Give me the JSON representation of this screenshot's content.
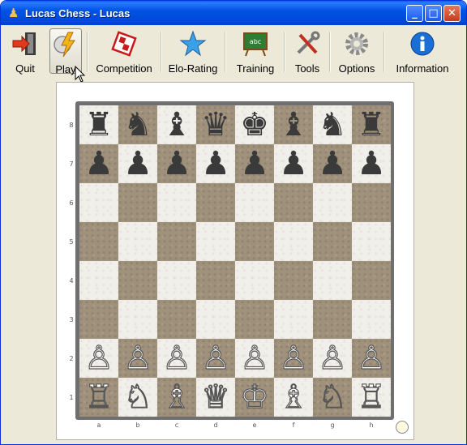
{
  "window": {
    "title": "Lucas Chess - Lucas"
  },
  "titlebar": {
    "minimize": "_",
    "maximize": "□",
    "close": "✕"
  },
  "toolbar": {
    "items": [
      {
        "label": "Quit",
        "icon": "quit-door-icon"
      },
      {
        "label": "Play",
        "icon": "play-lightning-icon",
        "active": true
      },
      {
        "label": "Competition",
        "icon": "competition-flag-icon"
      },
      {
        "label": "Elo-Rating",
        "icon": "star-icon"
      },
      {
        "label": "Training",
        "icon": "chalkboard-icon"
      },
      {
        "label": "Tools",
        "icon": "tools-icon"
      },
      {
        "label": "Options",
        "icon": "gear-icon"
      },
      {
        "label": "Information",
        "icon": "info-icon"
      }
    ]
  },
  "board": {
    "ranks": [
      "8",
      "7",
      "6",
      "5",
      "4",
      "3",
      "2",
      "1"
    ],
    "files": [
      "a",
      "b",
      "c",
      "d",
      "e",
      "f",
      "g",
      "h"
    ],
    "position": [
      [
        "♜",
        "♞",
        "♝",
        "♛",
        "♚",
        "♝",
        "♞",
        "♜"
      ],
      [
        "♟",
        "♟",
        "♟",
        "♟",
        "♟",
        "♟",
        "♟",
        "♟"
      ],
      [
        "",
        "",
        "",
        "",
        "",
        "",
        "",
        ""
      ],
      [
        "",
        "",
        "",
        "",
        "",
        "",
        "",
        ""
      ],
      [
        "",
        "",
        "",
        "",
        "",
        "",
        "",
        ""
      ],
      [
        "",
        "",
        "",
        "",
        "",
        "",
        "",
        ""
      ],
      [
        "♙",
        "♙",
        "♙",
        "♙",
        "♙",
        "♙",
        "♙",
        "♙"
      ],
      [
        "♖",
        "♘",
        "♗",
        "♕",
        "♔",
        "♗",
        "♘",
        "♖"
      ]
    ],
    "side_to_move": "white"
  },
  "colors": {
    "light_square": "#f1efe9",
    "dark_square": "#a0917c",
    "titlebar": "#0054e3"
  }
}
